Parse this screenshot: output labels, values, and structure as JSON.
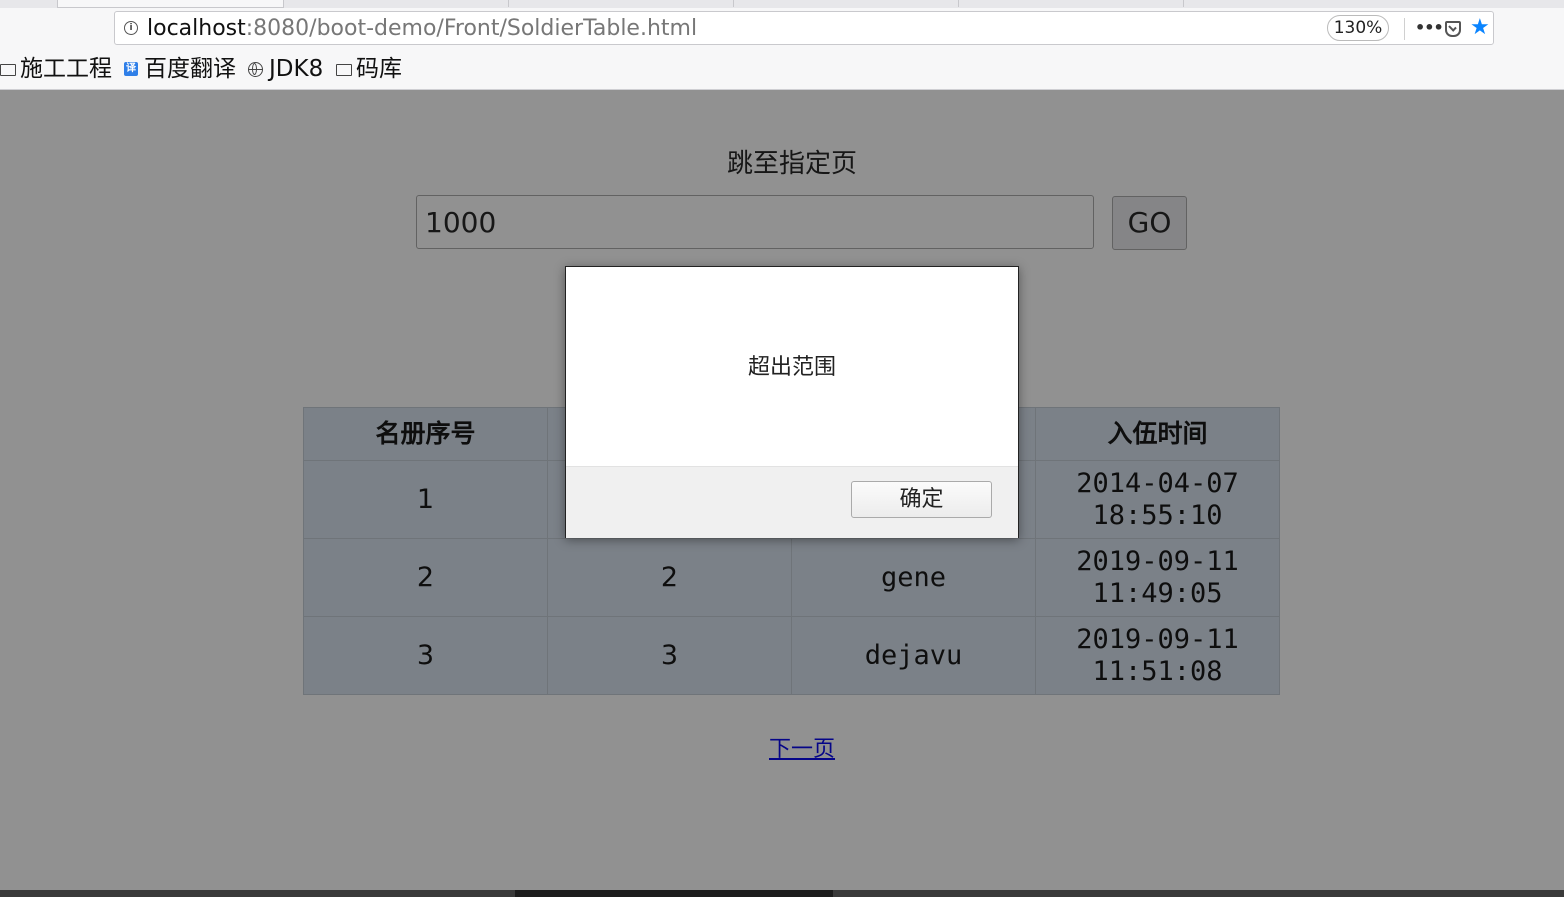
{
  "browser": {
    "url_host": "localhost",
    "url_rest": ":8080/boot-demo/Front/SoldierTable.html",
    "zoom": "130%",
    "accent_color": "#0a84ff",
    "icons": [
      "info-icon",
      "more-icon",
      "pocket-icon",
      "star-icon"
    ]
  },
  "bookmarks": [
    {
      "label": "施工工程",
      "icon": "folder-icon"
    },
    {
      "label": "百度翻译",
      "icon": "baidu-translate-icon",
      "icon_glyph": "译"
    },
    {
      "label": "JDK8",
      "icon": "globe-icon"
    },
    {
      "label": "码库",
      "icon": "folder-icon"
    }
  ],
  "page": {
    "jump_title": "跳至指定页",
    "page_input_value": "1000",
    "go_label": "GO",
    "next_link": "下一页"
  },
  "table": {
    "headers": [
      "名册序号",
      "",
      "",
      "入伍时间"
    ],
    "rows": [
      {
        "c1": "1",
        "c2": "",
        "c3": "",
        "date": "2014-04-07",
        "time": "18:55:10"
      },
      {
        "c1": "2",
        "c2": "2",
        "c3": "gene",
        "date": "2019-09-11",
        "time": "11:49:05"
      },
      {
        "c1": "3",
        "c2": "3",
        "c3": "dejavu",
        "date": "2019-09-11",
        "time": "11:51:08"
      }
    ]
  },
  "dialog": {
    "message": "超出范围",
    "ok_label": "确定"
  }
}
